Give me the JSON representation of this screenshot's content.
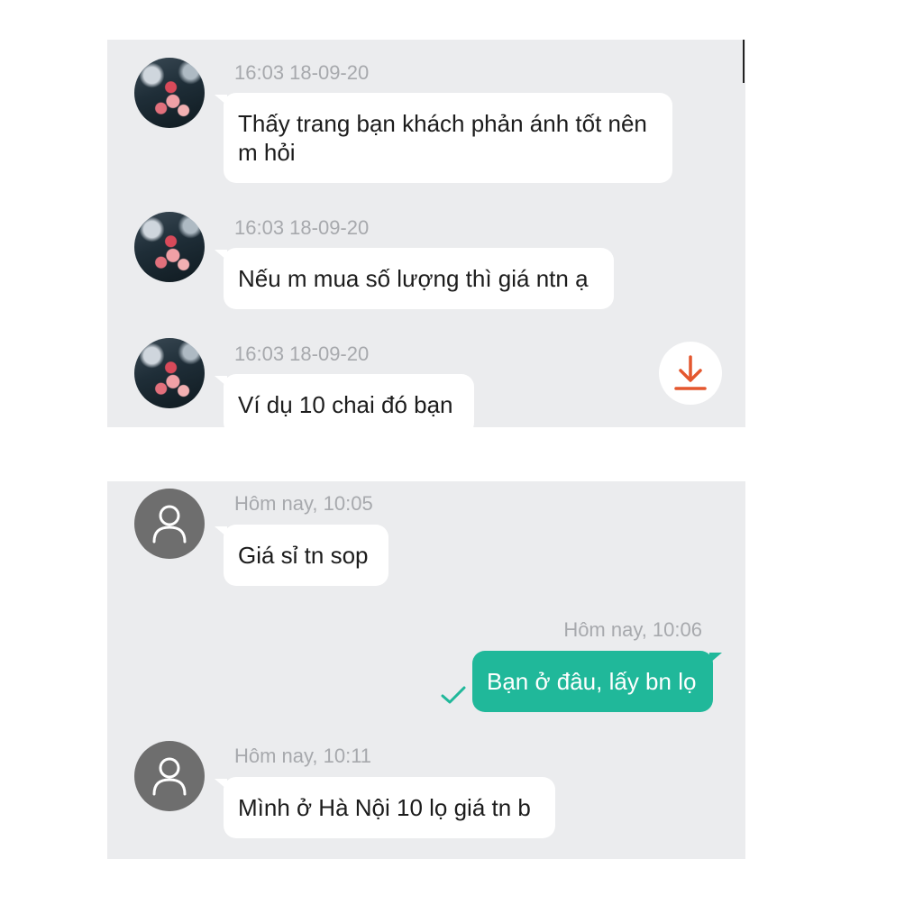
{
  "top_panel": {
    "messages": [
      {
        "time": "16:03 18-09-20",
        "text": "Thấy trang bạn khách phản ánh tốt nên m hỏi"
      },
      {
        "time": "16:03 18-09-20",
        "text": "Nếu m mua số lượng thì giá ntn ạ"
      },
      {
        "time": "16:03 18-09-20",
        "text": "Ví dụ 10 chai đó bạn"
      }
    ],
    "download_icon": "download-icon",
    "download_color": "#e4572e"
  },
  "bottom_panel": {
    "messages": [
      {
        "time": "Hôm nay, 10:05",
        "text": "Giá sỉ tn sop"
      },
      {
        "time": "Hôm nay, 10:06",
        "text": "Bạn ở đâu, lấy bn lọ"
      },
      {
        "time": "Hôm nay, 10:11",
        "text": "Mình ở Hà Nội 10 lọ giá tn b"
      }
    ],
    "sent_color": "#20b89a",
    "check_icon": "check-icon"
  }
}
